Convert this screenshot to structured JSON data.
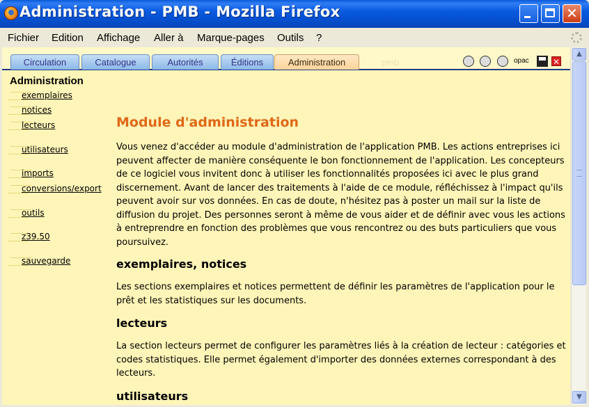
{
  "window": {
    "title": "Administration - PMB - Mozilla Firefox"
  },
  "menu": [
    "Fichier",
    "Edition",
    "Affichage",
    "Aller à",
    "Marque-pages",
    "Outils",
    "?"
  ],
  "tabs": [
    {
      "label": "Circulation",
      "active": false
    },
    {
      "label": "Catalogue",
      "active": false
    },
    {
      "label": "Autorités",
      "active": false
    },
    {
      "label": "Éditions",
      "active": false
    },
    {
      "label": "Administration",
      "active": true
    }
  ],
  "tab_ghost": "pmb",
  "toolbar_icons": [
    "hourglass-icon",
    "help-icon",
    "gear-icon",
    "opac-icon",
    "save-icon",
    "close-icon"
  ],
  "toolbar": {
    "opac_label": "opac",
    "close_label": "✕"
  },
  "sidebar": {
    "title": "Administration",
    "links": [
      "exemplaires",
      "notices",
      "lecteurs",
      "utilisateurs",
      "imports",
      "conversions/export",
      "outils",
      "z39.50",
      "sauvegarde"
    ]
  },
  "main": {
    "heading": "Module d'administration",
    "intro": "Vous venez d'accéder au module d'administration de l'application PMB. Les actions entreprises ici peuvent affecter de manière conséquente le bon fonctionnement de l'application. Les concepteurs de ce logiciel vous invitent donc à utiliser les fonctionnalités proposées ici avec le plus grand discernement. Avant de lancer des traitements à l'aide de ce module, réfléchissez à l'impact qu'ils peuvent avoir sur vos données. En cas de doute, n'hésitez pas à poster un mail sur la liste de diffusion du projet. Des personnes seront à même de vous aider et de définir avec vous les actions à entreprendre en fonction des problèmes que vous rencontrez ou des buts particuliers que vous poursuivez.",
    "sections": [
      {
        "title": "exemplaires, notices",
        "text": "Les sections exemplaires et notices permettent de définir les paramètres de l'application pour le prêt et les statistiques sur les documents."
      },
      {
        "title": "lecteurs",
        "text": "La section lecteurs permet de configurer les paramètres liés à la création de lecteur : catégories et codes statistiques. Elle permet également d'importer des données externes correspondant à des lecteurs."
      },
      {
        "title": "utilisateurs",
        "text": ""
      }
    ]
  },
  "scrollbar": {
    "up": "▲",
    "down": "▼"
  },
  "colors": {
    "content_bg": "#fff5b8",
    "heading": "#e06818",
    "titlebar": "#0a5ae0",
    "active_tab": "#fdd49a"
  }
}
